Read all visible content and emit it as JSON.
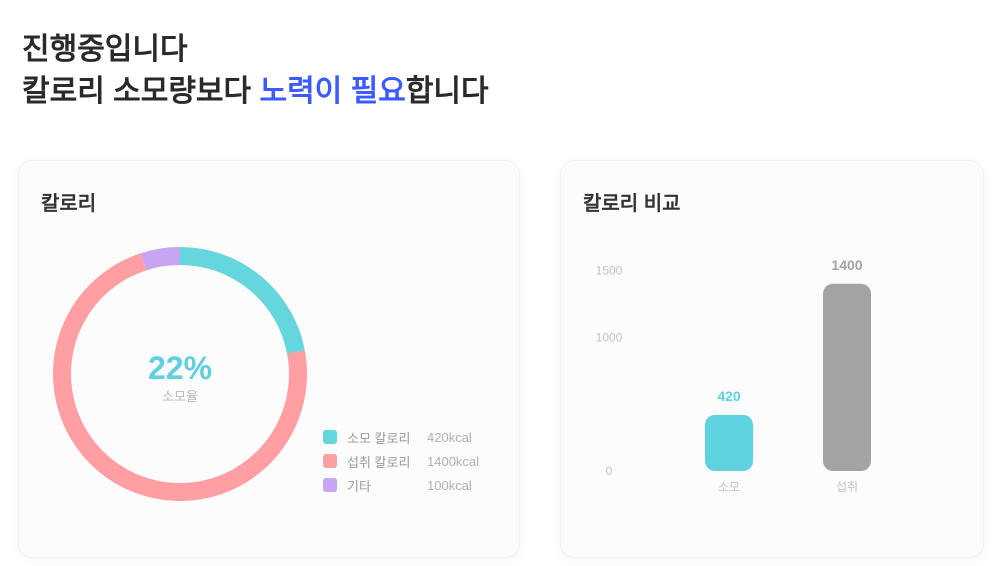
{
  "header": {
    "line1": "진행중입니다",
    "line2_prefix": "칼로리 소모량보다 ",
    "line2_highlight": "노력이 필요",
    "line2_suffix": "합니다"
  },
  "donut_card": {
    "title": "칼로리"
  },
  "bar_card": {
    "title": "칼로리 비교"
  },
  "chart_data": [
    {
      "type": "pie",
      "title": "칼로리",
      "center_value": "22%",
      "center_sub": "소모율",
      "slices": [
        {
          "name": "소모 칼로리",
          "value": 22,
          "color": "#66d6de",
          "label_value": "420kcal"
        },
        {
          "name": "섭취 칼로리",
          "value": 73,
          "color": "#ff9fa3",
          "label_value": "1400kcal"
        },
        {
          "name": "기타",
          "value": 5,
          "color": "#c6a6f2",
          "label_value": "100kcal"
        }
      ]
    },
    {
      "type": "bar",
      "title": "칼로리 비교",
      "categories": [
        "소모",
        "섭취"
      ],
      "values": [
        420,
        1400
      ],
      "value_labels": [
        "420",
        "1400"
      ],
      "colors": [
        "#5ed2de",
        "#a3a3a3"
      ],
      "yticks": [
        "1500",
        "1000",
        "0"
      ],
      "ylim": [
        0,
        1600
      ],
      "grid": false
    }
  ]
}
